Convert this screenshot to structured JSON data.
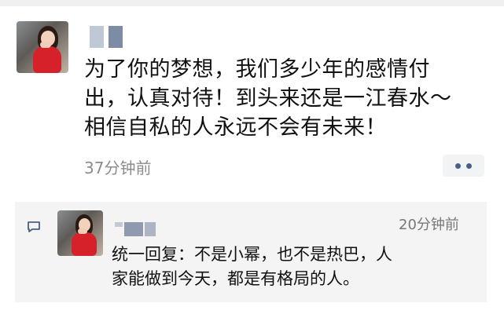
{
  "post": {
    "author_avatar": "avatar-woman-red",
    "text_lines": [
      "为了你的梦想，我们多少年的感情付",
      "出，认真对待！到头来还是一江春水～",
      "相信自私的人永远不会有未来！"
    ],
    "time": "37分钟前",
    "more_icon": "ellipsis-icon"
  },
  "comment": {
    "icon": "comment-bubble-icon",
    "avatar": "avatar-woman-red",
    "time": "20分钟前",
    "text_lines": [
      "统一回复：不是小幂，也不是热巴，人",
      "家能做到今天，都是有格局的人。"
    ]
  },
  "colors": {
    "time_gray": "#8c8c8c",
    "link_blue": "#4a5f86",
    "comment_bg": "#f4f4f4"
  }
}
